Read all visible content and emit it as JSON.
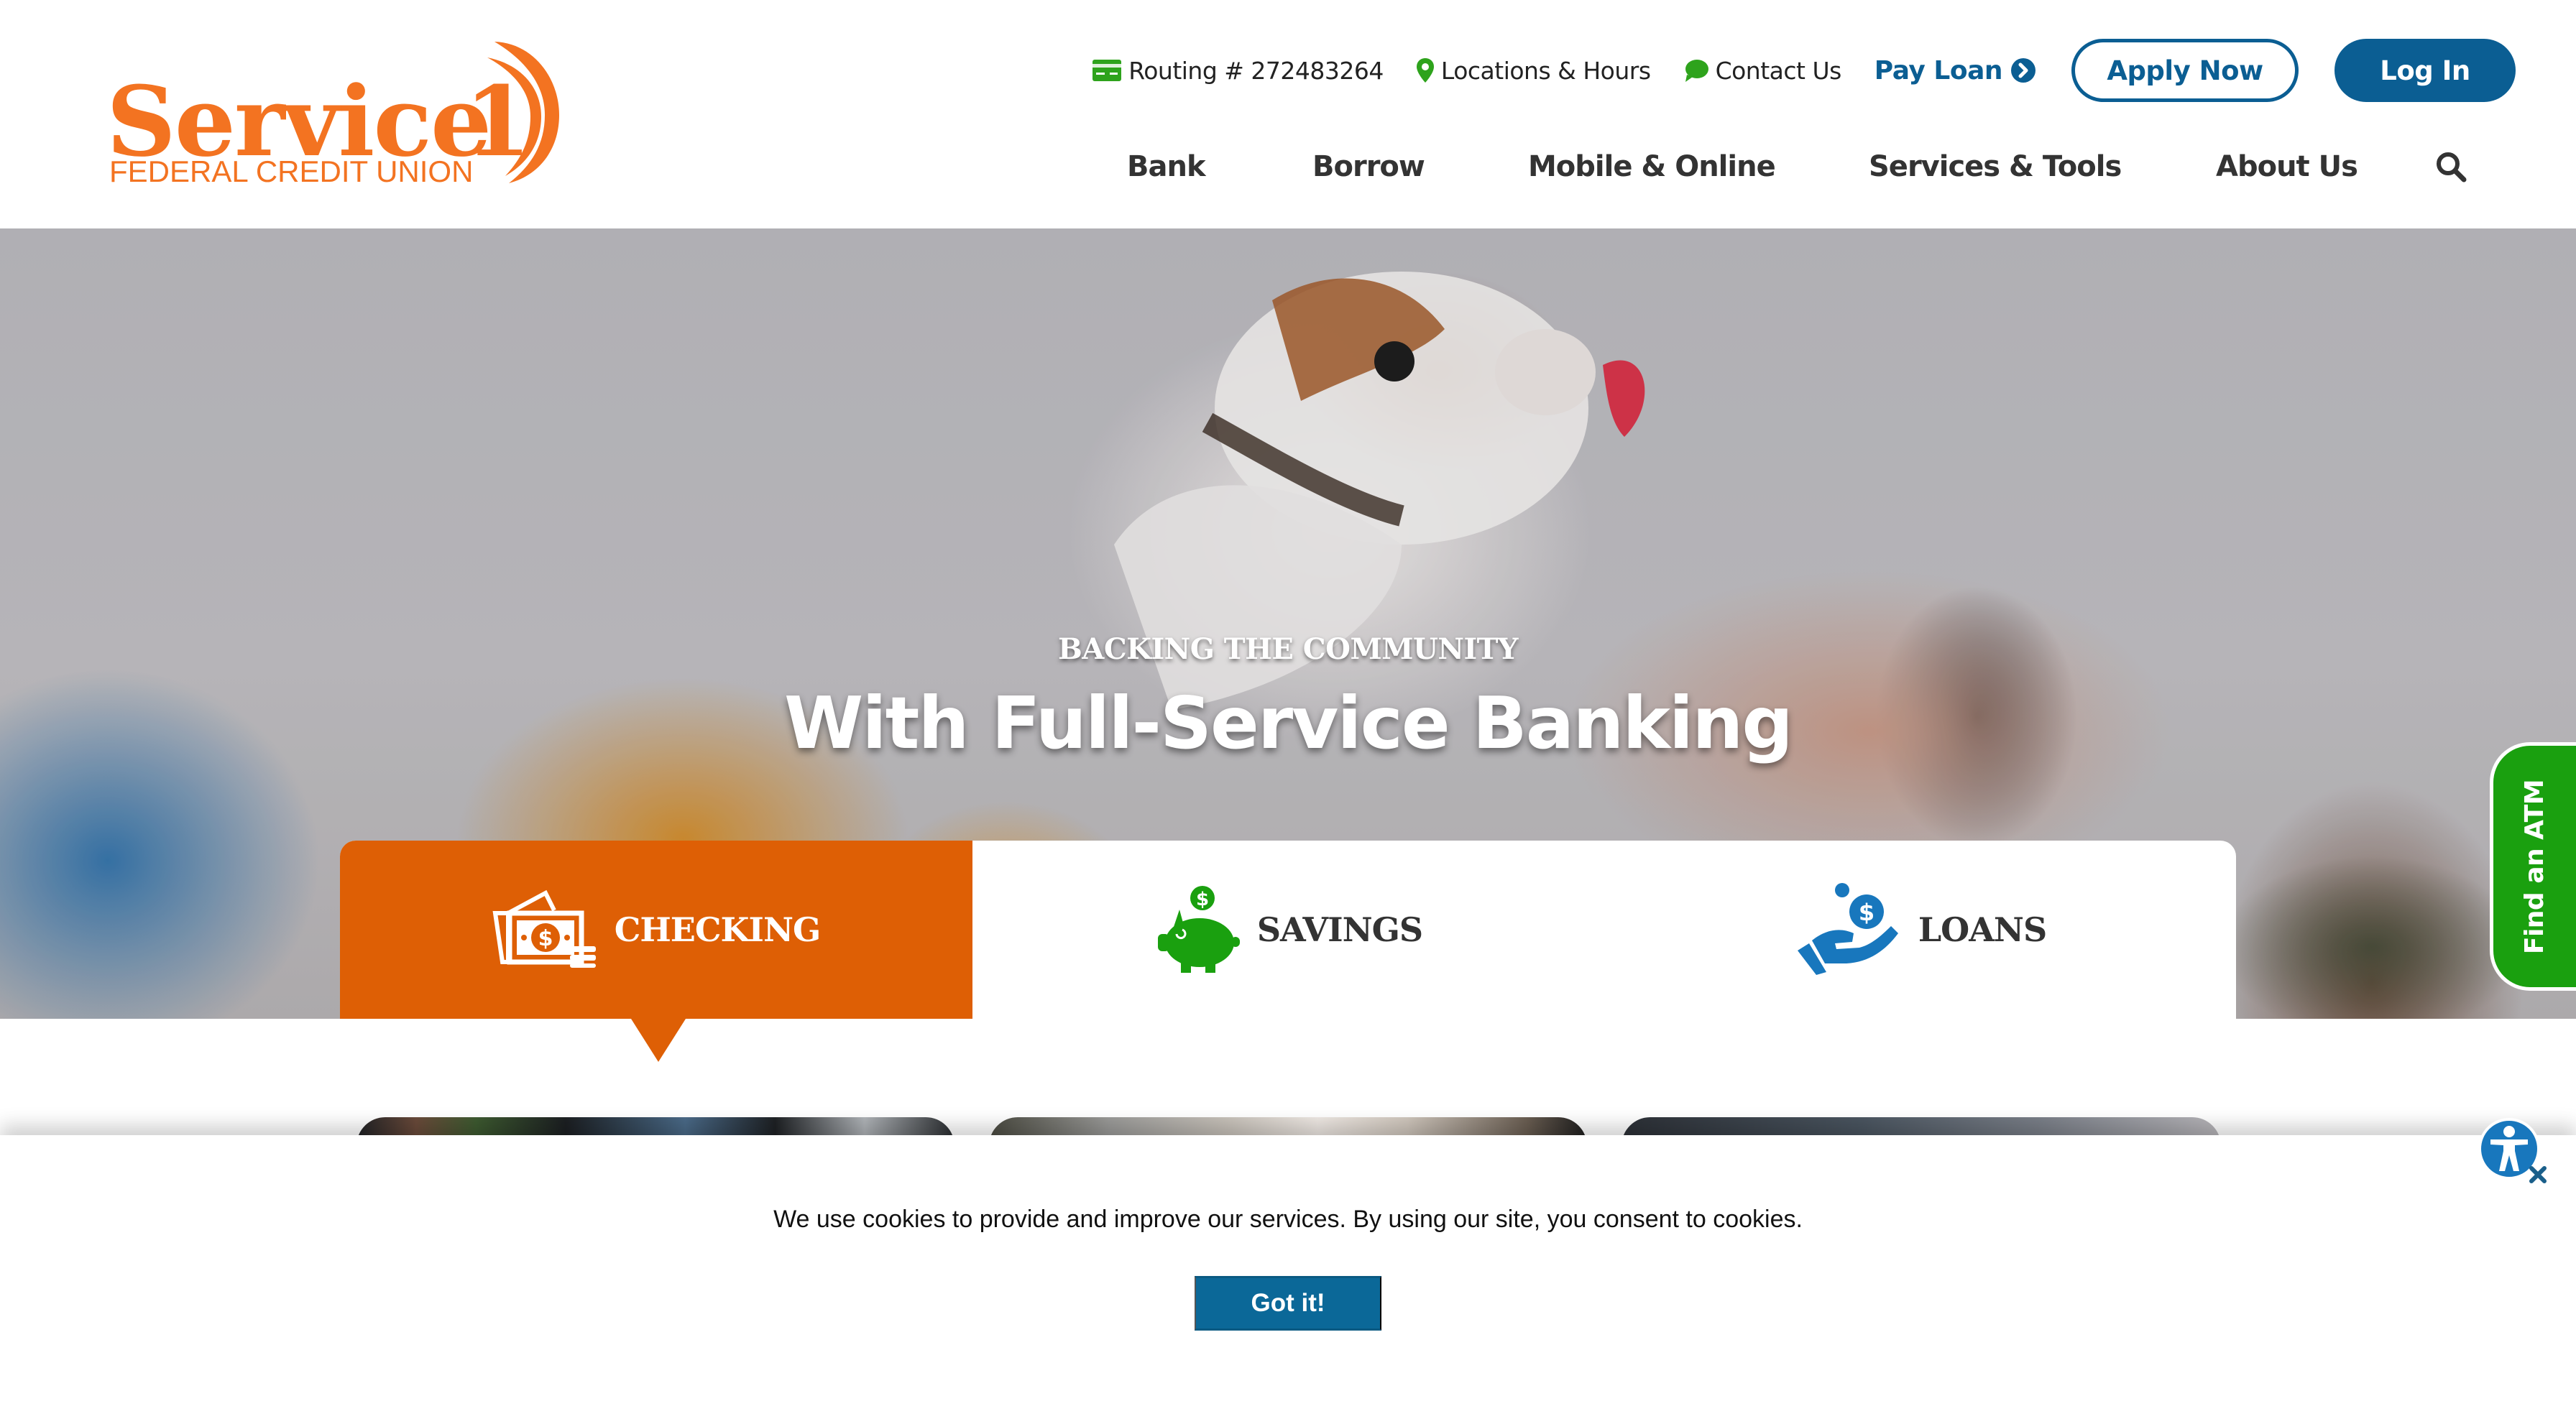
{
  "brand": {
    "name": "Service",
    "numeral": "1",
    "tagline": "FEDERAL CREDIT UNION",
    "colors": {
      "orange": "#f37321",
      "tab_orange": "#de5f05",
      "blue": "#0b5e93",
      "green": "#1aa00f",
      "text": "#333333"
    }
  },
  "utility": {
    "routing": {
      "icon": "routing-card-icon",
      "label": "Routing # 272483264"
    },
    "locations": {
      "icon": "map-pin-icon",
      "label": "Locations & Hours"
    },
    "contact": {
      "icon": "chat-bubble-icon",
      "label": "Contact Us"
    },
    "pay_loan": {
      "label": "Pay Loan",
      "icon": "chevron-right-circle-icon"
    },
    "apply_now": "Apply Now",
    "log_in": "Log In"
  },
  "nav": {
    "items": [
      {
        "label": "Bank"
      },
      {
        "label": "Borrow"
      },
      {
        "label": "Mobile & Online"
      },
      {
        "label": "Services & Tools"
      },
      {
        "label": "About Us"
      }
    ],
    "search_icon": "search-icon"
  },
  "hero": {
    "kicker": "BACKING THE COMMUNITY",
    "title": "With Full-Service Banking",
    "atm_tab": "Find an ATM"
  },
  "tabs": [
    {
      "label": "CHECKING",
      "icon": "cash-icon",
      "active": true
    },
    {
      "label": "SAVINGS",
      "icon": "piggy-bank-icon",
      "active": false
    },
    {
      "label": "LOANS",
      "icon": "hand-coin-icon",
      "active": false
    }
  ],
  "cookie": {
    "message": "We use cookies to provide and improve our services. By using our site, you consent to cookies.",
    "button": "Got it!"
  },
  "accessibility": {
    "icon": "accessibility-icon",
    "close_icon": "close-icon"
  }
}
